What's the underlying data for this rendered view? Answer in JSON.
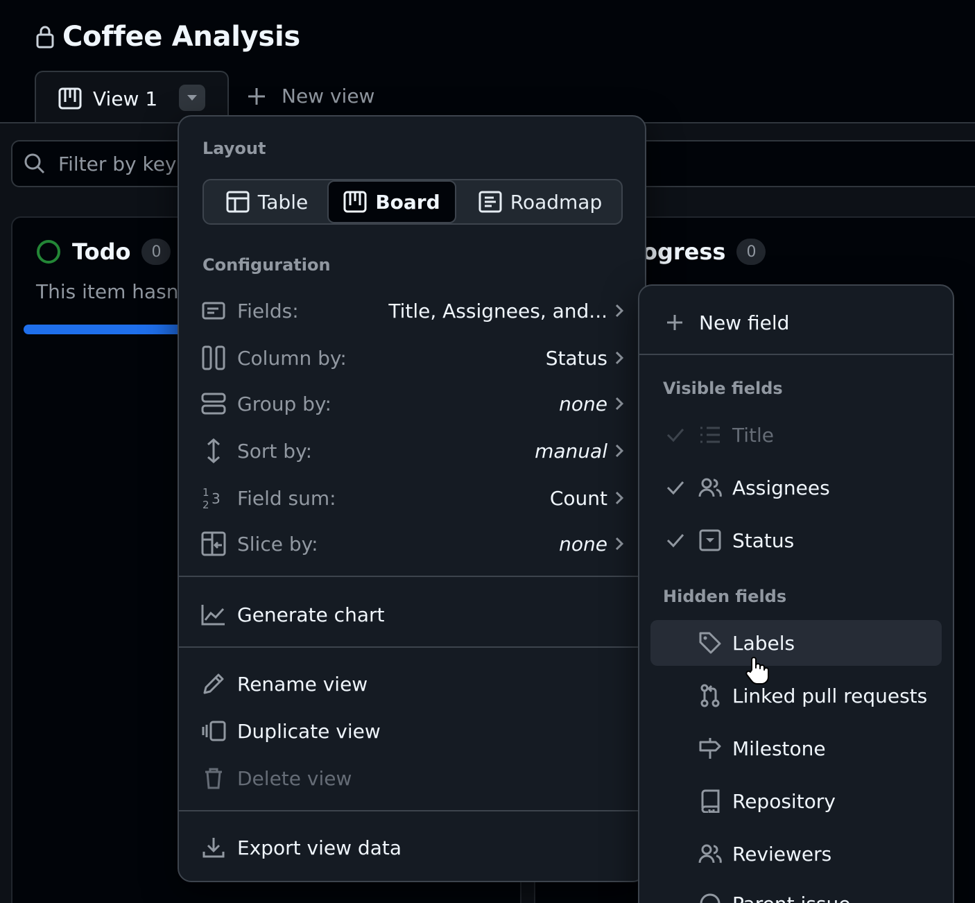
{
  "project": {
    "title": "Coffee Analysis"
  },
  "tabs": {
    "current_view": "View 1",
    "new_view": "New view"
  },
  "filter": {
    "placeholder": "Filter by key"
  },
  "columns": [
    {
      "title": "Todo",
      "count": "0",
      "description": "This item hasn"
    },
    {
      "title": "ogress",
      "count": "0"
    }
  ],
  "menu": {
    "layout_label": "Layout",
    "layouts": [
      "Table",
      "Board",
      "Roadmap"
    ],
    "active_layout": "Board",
    "configuration_label": "Configuration",
    "config": [
      {
        "key": "Fields:",
        "value": "Title, Assignees, and...",
        "icon": "note-icon"
      },
      {
        "key": "Column by:",
        "value": "Status",
        "icon": "columns-icon"
      },
      {
        "key": "Group by:",
        "value": "none",
        "icon": "rows-icon"
      },
      {
        "key": "Sort by:",
        "value": "manual",
        "icon": "sort-icon"
      },
      {
        "key": "Field sum:",
        "value": "Count",
        "icon": "number-icon"
      },
      {
        "key": "Slice by:",
        "value": "none",
        "icon": "slice-icon"
      }
    ],
    "generate_chart": "Generate chart",
    "rename_view": "Rename view",
    "duplicate_view": "Duplicate view",
    "delete_view": "Delete view",
    "export_view_data": "Export view data"
  },
  "fields_menu": {
    "new_field": "New field",
    "visible_label": "Visible fields",
    "visible": [
      {
        "label": "Title",
        "checked": true,
        "disabled": true,
        "icon": "list-icon"
      },
      {
        "label": "Assignees",
        "checked": true,
        "icon": "people-icon"
      },
      {
        "label": "Status",
        "checked": true,
        "icon": "single-select-icon"
      }
    ],
    "hidden_label": "Hidden fields",
    "hidden": [
      {
        "label": "Labels",
        "icon": "tag-icon",
        "hovered": true
      },
      {
        "label": "Linked pull requests",
        "icon": "pull-request-icon"
      },
      {
        "label": "Milestone",
        "icon": "milestone-icon"
      },
      {
        "label": "Repository",
        "icon": "repo-icon"
      },
      {
        "label": "Reviewers",
        "icon": "people-icon"
      },
      {
        "label": "Parent issue",
        "icon": "issue-icon"
      }
    ]
  },
  "colors": {
    "background": "#010409",
    "surface": "#151b23",
    "accent": "#1f6feb",
    "todo_status": "#238636"
  }
}
